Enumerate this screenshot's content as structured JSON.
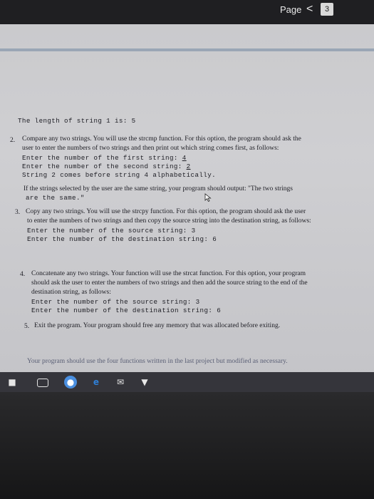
{
  "toolbar": {
    "page_label": "Page",
    "back_icon": "<",
    "page_number": "3"
  },
  "document": {
    "length_line": "The length of string 1 is: 5",
    "item2": {
      "number": "2.",
      "line1": "Compare any two strings. You will use the strcmp function. For this option, the program should ask the",
      "line2": "user to enter the numbers of two strings and then print out which string comes first, as follows:",
      "prompt1": "Enter the number of the first string: ",
      "prompt1_value": "4",
      "prompt2": "Enter the number of the second string: ",
      "prompt2_value": "2",
      "result": "String 2 comes before string 4 alphabetically.",
      "same_line1": "If the strings selected by the user are the same string, your program should output: \"The two strings",
      "same_line2": "are the same.\""
    },
    "item3": {
      "number": "3.",
      "line1": "Copy any two strings. You will use the strcpy function. For this option, the program should ask the user",
      "line2": "to enter the numbers of two strings and then copy the source string into the destination string, as follows:",
      "prompt1": "Enter the number of the source string: ",
      "prompt1_value": "3",
      "prompt2": "Enter the number of the destination string: ",
      "prompt2_value": "6"
    },
    "item4": {
      "number": "4.",
      "line1": "Concatenate any two strings. Your function will use the strcat function. For this option, your program",
      "line2": "should ask the user to enter the numbers of two strings and then add the source string to the end of the",
      "line3": "destination string, as follows:",
      "prompt1": "Enter the number of the source string: ",
      "prompt1_value": "3",
      "prompt2": "Enter the number of the destination string: ",
      "prompt2_value": "6"
    },
    "item5": {
      "number": "5.",
      "line1": "Exit the program. Your program should free any memory that was allocated before exiting."
    },
    "footer_note": "Your program should use the four functions written in the last project but modified as necessary."
  },
  "taskbar": {
    "icons": [
      "windows-icon",
      "task-view-icon",
      "chrome-icon",
      "edge-icon",
      "mail-icon",
      "store-icon"
    ],
    "colors": {
      "chrome": "#4a8fe0",
      "edge": "#2f7fd6",
      "store": "#e8e8e8"
    }
  }
}
